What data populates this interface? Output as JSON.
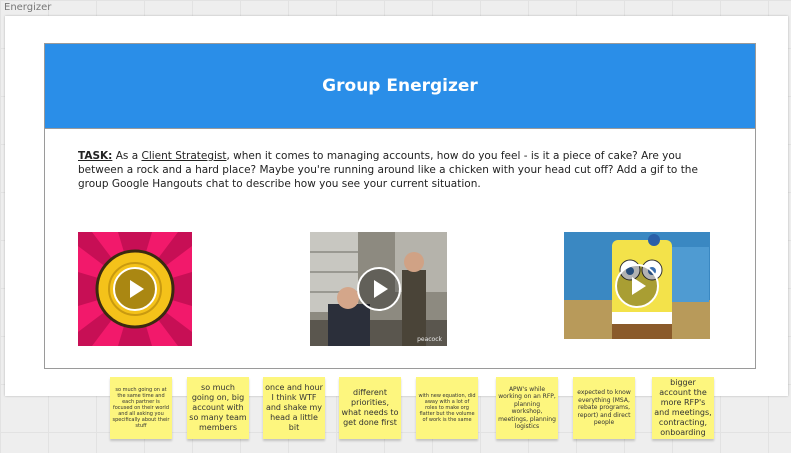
{
  "frame": {
    "label": "Energizer"
  },
  "card": {
    "title": "Group Energizer",
    "task_label": "TASK:",
    "task_as": " As a ",
    "task_role": "Client Strategist",
    "task_text": ", when it comes to managing accounts, how do you feel - is it a piece of cake? Are you between a rock and a hard place? Maybe you're running around like a chicken with your head cut off? Add a gif to the group Google Hangouts chat to describe how you see your current situation."
  },
  "gifs": [
    {
      "name": "pink-sun-gif"
    },
    {
      "name": "office-scene-gif",
      "watermark": "peacock"
    },
    {
      "name": "spongebob-gif"
    }
  ],
  "stickies": [
    {
      "text": "so much going on at the same time and each partner is focused on their world and all asking you specifically about their stuff"
    },
    {
      "text": "so much going on, big account with so many team members"
    },
    {
      "text": "once and hour I think WTF and shake my head a little bit"
    },
    {
      "text": "different priorities, what needs to get done first"
    },
    {
      "text": "with new equation, did away with a lot of roles to make org flatter but the volume of work is the same"
    },
    {
      "text": "APW's while working on an RFP, planning workshop, meetings, planning logistics"
    },
    {
      "text": "expected to know everything (MSA, rebate programs, report) and direct people"
    },
    {
      "text": "bigger account the more RFP's and meetings, contracting, onboarding"
    }
  ],
  "colors": {
    "header": "#2a8ee8",
    "sticky": "#fdf67e",
    "canvas": "#eeeeee"
  }
}
